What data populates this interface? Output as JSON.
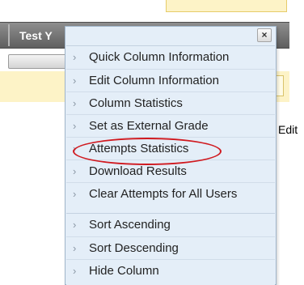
{
  "grid": {
    "column_title": "Test Y",
    "row_action": "Edit"
  },
  "menu": {
    "close_glyph": "×",
    "chevron_glyph": "›",
    "sections": [
      {
        "items": [
          {
            "label": "Quick Column Information"
          },
          {
            "label": "Edit Column Information"
          },
          {
            "label": "Column Statistics"
          },
          {
            "label": "Set as External Grade"
          },
          {
            "label": "Attempts Statistics"
          },
          {
            "label": "Download Results"
          },
          {
            "label": "Clear Attempts for All Users"
          }
        ]
      },
      {
        "items": [
          {
            "label": "Sort Ascending"
          },
          {
            "label": "Sort Descending"
          },
          {
            "label": "Hide Column"
          }
        ]
      }
    ]
  },
  "annotation": {
    "highlighted_item": "Attempts Statistics",
    "color": "#d0191f"
  }
}
